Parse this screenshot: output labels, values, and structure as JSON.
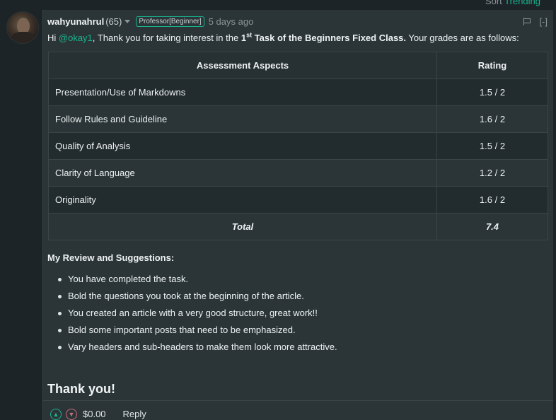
{
  "topbar": {
    "left": "Sort",
    "accent": "Trending"
  },
  "comment": {
    "username": "wahyunahrul",
    "reputation": "(65)",
    "badge": "Professor[Beginner]",
    "time": "5 days ago",
    "collapse": "[-]",
    "intro": {
      "hi": "Hi ",
      "mention": "@okay1",
      "text1": ", Thank you for taking interest in the ",
      "num": "1",
      "sup": "st",
      "bold": " Task of the Beginners Fixed Class.",
      "text2": " Your grades are as follows:"
    },
    "table": {
      "headers": [
        "Assessment Aspects",
        "Rating"
      ],
      "rows": [
        {
          "aspect": "Presentation/Use of Markdowns",
          "rating": "1.5 / 2"
        },
        {
          "aspect": "Follow Rules and Guideline",
          "rating": "1.6 / 2"
        },
        {
          "aspect": "Quality of Analysis",
          "rating": "1.5 / 2"
        },
        {
          "aspect": "Clarity of Language",
          "rating": "1.2 / 2"
        },
        {
          "aspect": "Originality",
          "rating": "1.6 / 2"
        }
      ],
      "total_label": "Total",
      "total_value": "7.4"
    },
    "review_title": "My Review and Suggestions:",
    "suggestions": [
      "You have completed the task.",
      "Bold the questions you took at the beginning of the article.",
      "You created an article with a very good structure, great work!!",
      "Bold some important posts that need to be emphasized.",
      "Vary headers and sub-headers to make them look more attractive."
    ],
    "closing": "Thank you!",
    "footer": {
      "payout": "$0.00",
      "reply": "Reply"
    }
  },
  "colors": {
    "accent": "#19b38e",
    "background": "#1c2427",
    "card": "#2b3537",
    "downvote": "#c96b7a"
  }
}
